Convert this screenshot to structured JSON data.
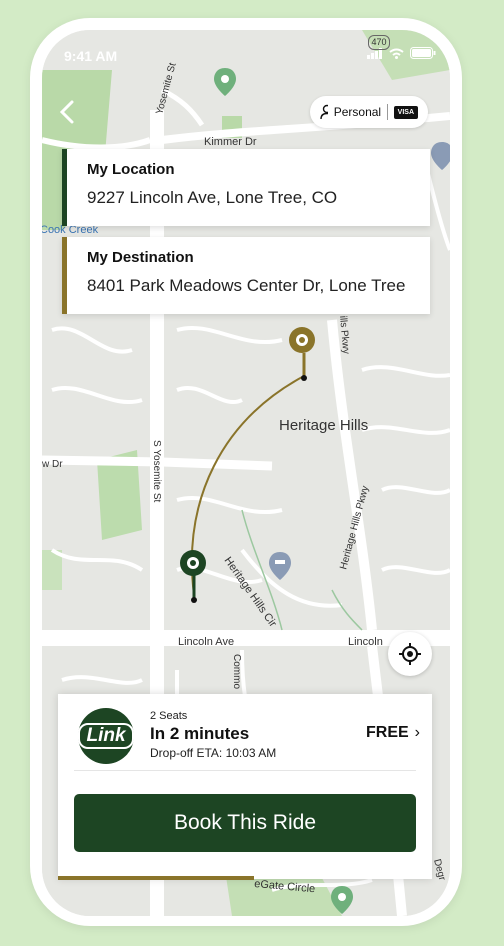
{
  "status": {
    "time": "9:41 AM",
    "badge": "470"
  },
  "pill": {
    "label": "Personal",
    "card": "VISA"
  },
  "location": {
    "title": "My Location",
    "value": "9227 Lincoln Ave, Lone Tree, CO"
  },
  "destination": {
    "title": "My Destination",
    "value": "8401 Park Meadows Center Dr, Lone Tree"
  },
  "map_labels": {
    "kimmer": "Kimmer Dr",
    "cook": "Cook Creek",
    "yosemite_top": "Yosemite St",
    "yosemite": "S Yosemite St",
    "heritage_hills": "Heritage Hills",
    "heritage_pkwy": "Heritage Hills Pkwy",
    "hills_pkwy": "ills Pkwy",
    "heritage_cir": "Heritage Hills Cir",
    "lincoln_ave": "Lincoln Ave",
    "lincoln": "Lincoln",
    "w_dr": "w Dr",
    "commo": "Commo",
    "gate_circle": "eGate Circle",
    "degr": "Degr"
  },
  "ride": {
    "logo": "Link",
    "seats": "2 Seats",
    "time": "In 2 minutes",
    "eta": "Drop-off ETA: 10:03 AM",
    "price": "FREE",
    "price_chevron": "›",
    "book": "Book This Ride"
  },
  "colors": {
    "brand_green": "#1d4523",
    "gold": "#8a742a",
    "background": "#d3ebc6"
  },
  "icons": [
    "back-icon",
    "person-icon",
    "visa-icon",
    "pin-icon",
    "locate-icon",
    "chevron-right-icon",
    "signal-icon",
    "wifi-icon",
    "battery-icon"
  ]
}
